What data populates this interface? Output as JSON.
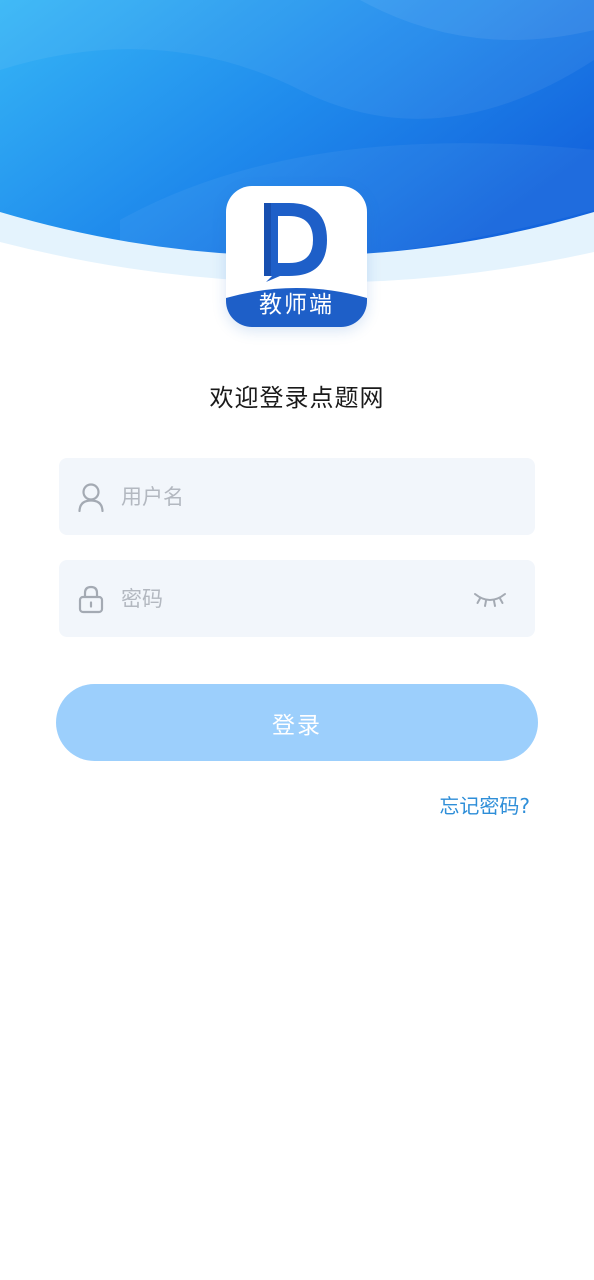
{
  "app": {
    "badge_label": "教师端",
    "welcome_text": "欢迎登录点题网"
  },
  "login_form": {
    "username": {
      "placeholder": "用户名",
      "value": "",
      "icon": "user-icon"
    },
    "password": {
      "placeholder": "密码",
      "value": "",
      "icon": "lock-icon",
      "toggle_icon": "eye-closed-icon"
    },
    "submit_label": "登录",
    "forgot_label": "忘记密码?"
  },
  "colors": {
    "header_gradient_start": "#35b4f5",
    "header_gradient_end": "#1669df",
    "brand_blue": "#1e5fc8",
    "input_bg": "#f2f6fb",
    "button_bg": "#9ccffc",
    "link": "#2e8ed8"
  }
}
